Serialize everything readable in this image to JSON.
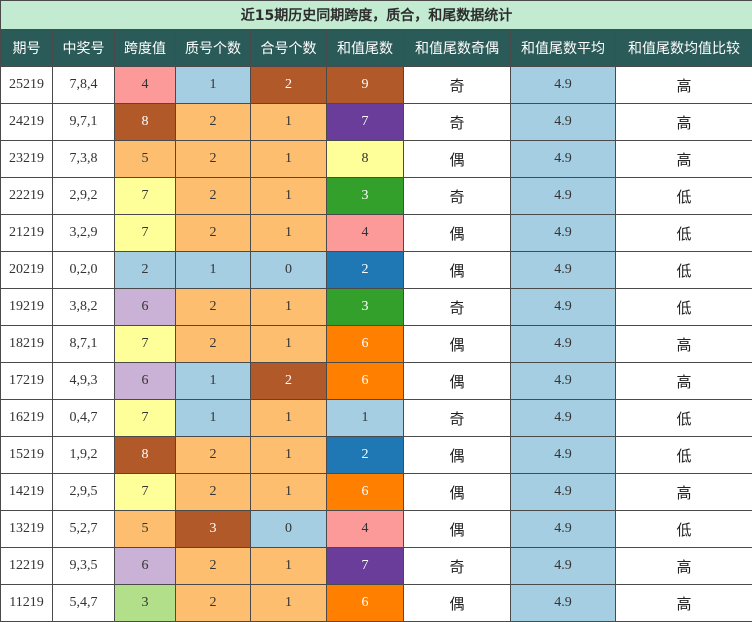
{
  "title": "近15期历史同期跨度，质合，和尾数据统计",
  "headers": [
    "期号",
    "中奖号",
    "跨度值",
    "质号个数",
    "合号个数",
    "和值尾数",
    "和值尾数奇偶",
    "和值尾数平均",
    "和值尾数均值比较"
  ],
  "palette": {
    "blue": "#a6cee3",
    "orange": "#fdbf6f",
    "brown": "#b15928",
    "purple": "#6a3d9a",
    "yellow": "#ffff99",
    "green": "#33a02c",
    "pink": "#fb9a99",
    "dark_blue": "#1f78b4",
    "lavender": "#cab2d6",
    "dark_orange": "#ff7f00",
    "light_green": "#b2df8a",
    "header_bg": "#2b5b58",
    "title_bg": "#c2ebd1"
  },
  "rows": [
    {
      "issue": "25219",
      "numbers": "7,8,4",
      "span": "4",
      "span_color": "pink",
      "prime": "1",
      "prime_color": "blue",
      "composite": "2",
      "composite_color": "brown",
      "tail": "9",
      "tail_color": "brown",
      "parity": "奇",
      "avg": "4.9",
      "compare": "高"
    },
    {
      "issue": "24219",
      "numbers": "9,7,1",
      "span": "8",
      "span_color": "brown",
      "prime": "2",
      "prime_color": "orange",
      "composite": "1",
      "composite_color": "orange",
      "tail": "7",
      "tail_color": "purple",
      "parity": "奇",
      "avg": "4.9",
      "compare": "高"
    },
    {
      "issue": "23219",
      "numbers": "7,3,8",
      "span": "5",
      "span_color": "orange",
      "prime": "2",
      "prime_color": "orange",
      "composite": "1",
      "composite_color": "orange",
      "tail": "8",
      "tail_color": "yellow",
      "parity": "偶",
      "avg": "4.9",
      "compare": "高"
    },
    {
      "issue": "22219",
      "numbers": "2,9,2",
      "span": "7",
      "span_color": "yellow",
      "prime": "2",
      "prime_color": "orange",
      "composite": "1",
      "composite_color": "orange",
      "tail": "3",
      "tail_color": "green",
      "parity": "奇",
      "avg": "4.9",
      "compare": "低"
    },
    {
      "issue": "21219",
      "numbers": "3,2,9",
      "span": "7",
      "span_color": "yellow",
      "prime": "2",
      "prime_color": "orange",
      "composite": "1",
      "composite_color": "orange",
      "tail": "4",
      "tail_color": "pink",
      "parity": "偶",
      "avg": "4.9",
      "compare": "低"
    },
    {
      "issue": "20219",
      "numbers": "0,2,0",
      "span": "2",
      "span_color": "blue",
      "prime": "1",
      "prime_color": "blue",
      "composite": "0",
      "composite_color": "blue",
      "tail": "2",
      "tail_color": "dark_blue",
      "parity": "偶",
      "avg": "4.9",
      "compare": "低"
    },
    {
      "issue": "19219",
      "numbers": "3,8,2",
      "span": "6",
      "span_color": "lavender",
      "prime": "2",
      "prime_color": "orange",
      "composite": "1",
      "composite_color": "orange",
      "tail": "3",
      "tail_color": "green",
      "parity": "奇",
      "avg": "4.9",
      "compare": "低"
    },
    {
      "issue": "18219",
      "numbers": "8,7,1",
      "span": "7",
      "span_color": "yellow",
      "prime": "2",
      "prime_color": "orange",
      "composite": "1",
      "composite_color": "orange",
      "tail": "6",
      "tail_color": "dark_orange",
      "parity": "偶",
      "avg": "4.9",
      "compare": "高"
    },
    {
      "issue": "17219",
      "numbers": "4,9,3",
      "span": "6",
      "span_color": "lavender",
      "prime": "1",
      "prime_color": "blue",
      "composite": "2",
      "composite_color": "brown",
      "tail": "6",
      "tail_color": "dark_orange",
      "parity": "偶",
      "avg": "4.9",
      "compare": "高"
    },
    {
      "issue": "16219",
      "numbers": "0,4,7",
      "span": "7",
      "span_color": "yellow",
      "prime": "1",
      "prime_color": "blue",
      "composite": "1",
      "composite_color": "orange",
      "tail": "1",
      "tail_color": "blue",
      "parity": "奇",
      "avg": "4.9",
      "compare": "低"
    },
    {
      "issue": "15219",
      "numbers": "1,9,2",
      "span": "8",
      "span_color": "brown",
      "prime": "2",
      "prime_color": "orange",
      "composite": "1",
      "composite_color": "orange",
      "tail": "2",
      "tail_color": "dark_blue",
      "parity": "偶",
      "avg": "4.9",
      "compare": "低"
    },
    {
      "issue": "14219",
      "numbers": "2,9,5",
      "span": "7",
      "span_color": "yellow",
      "prime": "2",
      "prime_color": "orange",
      "composite": "1",
      "composite_color": "orange",
      "tail": "6",
      "tail_color": "dark_orange",
      "parity": "偶",
      "avg": "4.9",
      "compare": "高"
    },
    {
      "issue": "13219",
      "numbers": "5,2,7",
      "span": "5",
      "span_color": "orange",
      "prime": "3",
      "prime_color": "brown",
      "composite": "0",
      "composite_color": "blue",
      "tail": "4",
      "tail_color": "pink",
      "parity": "偶",
      "avg": "4.9",
      "compare": "低"
    },
    {
      "issue": "12219",
      "numbers": "9,3,5",
      "span": "6",
      "span_color": "lavender",
      "prime": "2",
      "prime_color": "orange",
      "composite": "1",
      "composite_color": "orange",
      "tail": "7",
      "tail_color": "purple",
      "parity": "奇",
      "avg": "4.9",
      "compare": "高"
    },
    {
      "issue": "11219",
      "numbers": "5,4,7",
      "span": "3",
      "span_color": "light_green",
      "prime": "2",
      "prime_color": "orange",
      "composite": "1",
      "composite_color": "orange",
      "tail": "6",
      "tail_color": "dark_orange",
      "parity": "偶",
      "avg": "4.9",
      "compare": "高"
    }
  ]
}
